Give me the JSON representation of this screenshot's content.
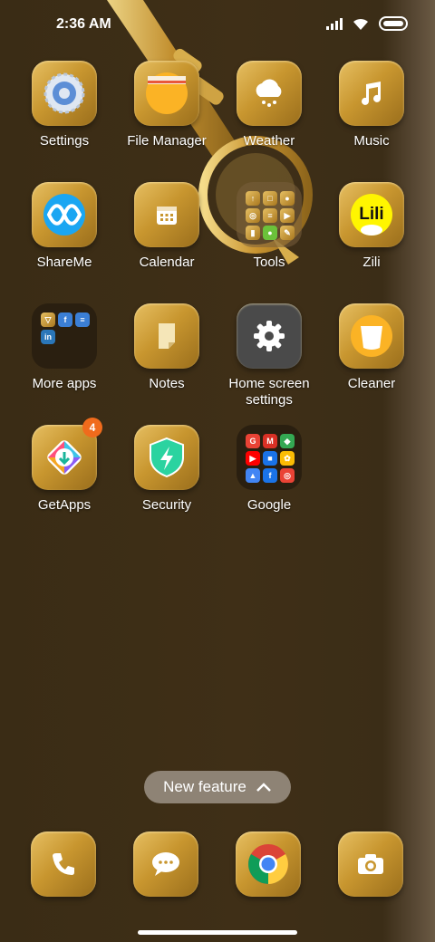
{
  "status": {
    "time": "2:36 AM"
  },
  "apps": {
    "settings": "Settings",
    "file_manager": "File Manager",
    "weather": "Weather",
    "music": "Music",
    "shareme": "ShareMe",
    "calendar": "Calendar",
    "tools": "Tools",
    "zili": "Zili",
    "more_apps": "More apps",
    "notes": "Notes",
    "home_screen_settings": "Home screen settings",
    "cleaner": "Cleaner",
    "getapps": "GetApps",
    "getapps_badge": "4",
    "security": "Security",
    "google": "Google"
  },
  "new_feature": {
    "label": "New feature"
  },
  "colors": {
    "gold": "#c8962f",
    "badge": "#f06b1c",
    "background": "#3e2f17"
  }
}
